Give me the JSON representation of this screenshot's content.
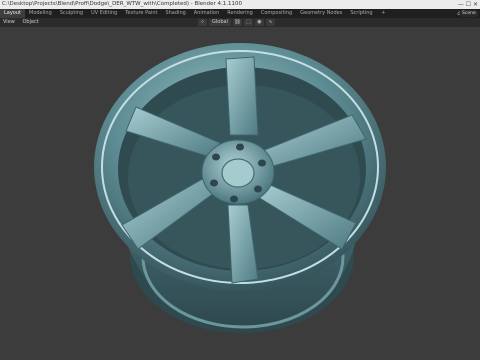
{
  "window": {
    "title": "C:\\Desktop\\Projects\\Blend\\Proff\\Dodge\\_DER_WTW_with\\Completed) - Blender 4.1.1100",
    "controls": "— ☐ ✕"
  },
  "workspaces": {
    "tabs": [
      "Layout",
      "Modeling",
      "Sculpting",
      "UV Editing",
      "Texture Paint",
      "Shading",
      "Animation",
      "Rendering",
      "Compositing",
      "Geometry Nodes",
      "Scripting"
    ],
    "active_index": 0,
    "add_label": "+",
    "scene_label": "Scene",
    "scene_icon": "⌂"
  },
  "viewport_header": {
    "menus": [
      "View",
      "Object"
    ],
    "transform_orientation": "Global",
    "tools": [
      "⊹",
      "⛓",
      "⬚",
      "◉",
      "∿"
    ]
  },
  "colors": {
    "wheel_base": "#5d8b93",
    "wheel_light": "#9bc3c8",
    "wheel_dark": "#2f4c52",
    "viewport_bg": "#3c3c3c"
  }
}
